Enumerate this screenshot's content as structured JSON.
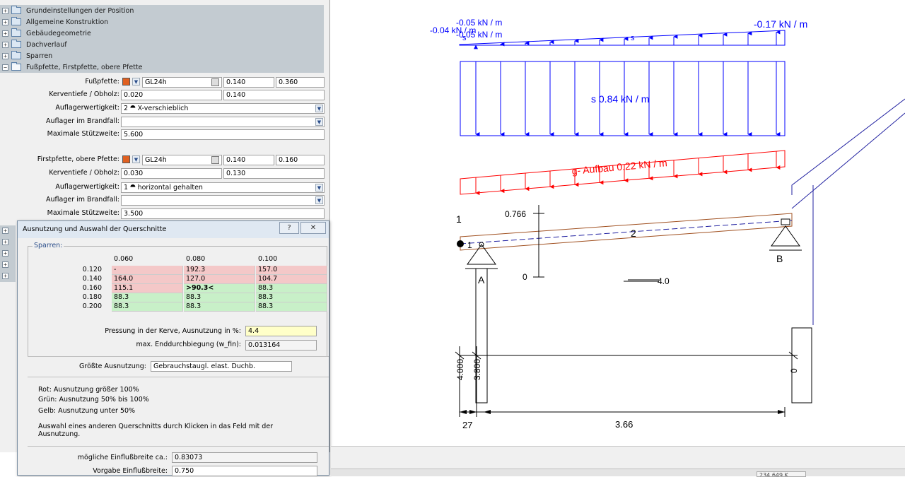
{
  "tree": {
    "items": [
      {
        "label": "Grundeinstellungen der Position",
        "open": false
      },
      {
        "label": "Allgemeine Konstruktion",
        "open": false
      },
      {
        "label": "Gebäudegeometrie",
        "open": false
      },
      {
        "label": "Dachverlauf",
        "open": false
      },
      {
        "label": "Sparren",
        "open": false
      },
      {
        "label": "Fußpfette, Firstpfette, obere Pfette",
        "open": true
      }
    ],
    "toggle_closed": "+",
    "toggle_open": "−"
  },
  "fusspfette": {
    "label": "Fußpfette:",
    "material": "GL24h",
    "width": "0.140",
    "height": "0.360",
    "kerv_label": "Kerventiefe / Obholz:",
    "kerv_depth": "0.020",
    "obholz": "0.140",
    "support_label": "Auflagerwertigkeit:",
    "support_value": "2 ⯊ X-verschieblich",
    "fire_label": "Auflager im Brandfall:",
    "fire_value": "",
    "span_label": "Maximale Stützweite:",
    "span_value": "5.600"
  },
  "firstpfette": {
    "label": "Firstpfette, obere Pfette:",
    "material": "GL24h",
    "width": "0.140",
    "height": "0.160",
    "kerv_label": "Kerventiefe / Obholz:",
    "kerv_depth": "0.030",
    "obholz": "0.130",
    "support_label": "Auflagerwertigkeit:",
    "support_value": "1 ⯊ horizontal gehalten",
    "fire_label": "Auflager im Brandfall:",
    "fire_value": "",
    "span_label": "Maximale Stützweite:",
    "span_value": "3.500"
  },
  "dialog": {
    "title": "Ausnutzung und Auswahl der Querschnitte",
    "help_btn": "?",
    "close_btn": "✕",
    "group_title": "Sparren:",
    "columns": [
      "0.060",
      "0.080",
      "0.100"
    ],
    "rows": [
      {
        "h": "0.120",
        "cells": [
          {
            "v": "-",
            "c": "red"
          },
          {
            "v": "192.3",
            "c": "red"
          },
          {
            "v": "157.0",
            "c": "red"
          }
        ]
      },
      {
        "h": "0.140",
        "cells": [
          {
            "v": "164.0",
            "c": "red"
          },
          {
            "v": "127.0",
            "c": "red"
          },
          {
            "v": "104.7",
            "c": "red"
          }
        ]
      },
      {
        "h": "0.160",
        "cells": [
          {
            "v": "115.1",
            "c": "red"
          },
          {
            "v": ">90.3<",
            "c": "green",
            "bold": true
          },
          {
            "v": "88.3",
            "c": "green"
          }
        ]
      },
      {
        "h": "0.180",
        "cells": [
          {
            "v": "88.3",
            "c": "green"
          },
          {
            "v": "88.3",
            "c": "green"
          },
          {
            "v": "88.3",
            "c": "green"
          }
        ]
      },
      {
        "h": "0.200",
        "cells": [
          {
            "v": "88.3",
            "c": "green"
          },
          {
            "v": "88.3",
            "c": "green"
          },
          {
            "v": "88.3",
            "c": "green"
          }
        ]
      }
    ],
    "pressung_label": "Pressung in der Kerve, Ausnutzung in %:",
    "pressung_value": "4.4",
    "durchbiegung_label": "max. Enddurchbiegung (w_fin):",
    "durchbiegung_value": "0.013164",
    "groesste_label": "Größte Ausnutzung:",
    "groesste_value": "Gebrauchstaugl. elast. Duchb.",
    "legend_red": "Rot: Ausnutzung größer 100%",
    "legend_green": "Grün: Ausnutzung 50% bis 100%",
    "legend_yellow": "Gelb: Ausnutzung unter 50%",
    "hint": "Auswahl eines anderen Querschnitts durch Klicken in das Feld mit der Ausnutzung.",
    "einfluss_label": "mögliche Einflußbreite ca.:",
    "einfluss_value": "0.83073",
    "vorgabe_label": "Vorgabe Einflußbreite:",
    "vorgabe_value": "0.750"
  },
  "drawing": {
    "snow_left_value": "-0.05 kN / m",
    "snow_left_value_2": "-0.04 kN / m",
    "snow_left_value_3": "-0.05 kN / m",
    "snow_right_value": "-0.17 kN / m",
    "s_label_small": "s",
    "s_label_small_2": "s",
    "s_load": "s 0.84 kN / m",
    "g_load": "g- Aufbau 0.22 kN / m",
    "node_1": "1",
    "node_1b": "1",
    "member_2": "2",
    "support_A": "A",
    "support_B": "B",
    "height_0766": "0.766",
    "height_0": "0",
    "slope_label": "4.0",
    "dim_4000": "4.000",
    "dim_3800": "3.800",
    "dim_0": "0",
    "dim_27": "27",
    "dim_366": "3.66"
  },
  "status": {
    "coordinate": "234.649 K"
  },
  "colors": {
    "tree_bg": "#c3cbd1",
    "load_blue": "#0000ff",
    "load_red": "#ff0000",
    "cell_red": "#f4c8c8",
    "cell_green": "#c8f0c8",
    "field_yellow": "#ffffc8"
  }
}
